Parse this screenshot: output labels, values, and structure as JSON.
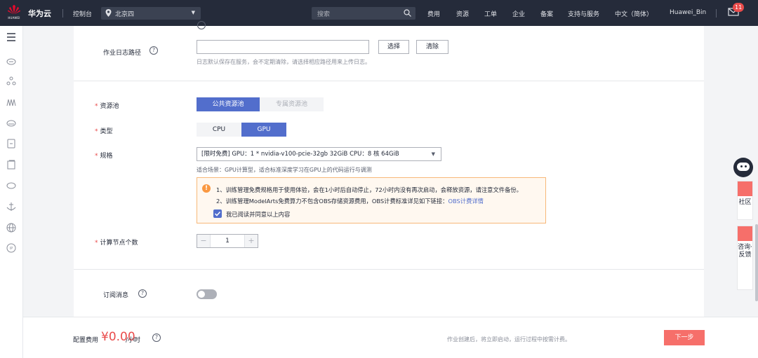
{
  "topbar": {
    "logo_word": "HUAWEI",
    "brand": "华为云",
    "console": "控制台",
    "region": "北京四",
    "search_placeholder": "搜索",
    "links": [
      "费用",
      "资源",
      "工单",
      "企业",
      "备案",
      "支持与服务",
      "中文（简体）",
      "Huawei_Bin"
    ],
    "mail_count": "11"
  },
  "sidebar": {
    "icons": [
      "menu-icon",
      "cloud-icon",
      "network-icon",
      "chart-icon",
      "cloud-storage-icon",
      "document-icon",
      "server-icon",
      "cloud-download-icon",
      "anchor-icon",
      "globe-icon",
      "ip-icon"
    ]
  },
  "form": {
    "log_path": {
      "label": "作业日志路径",
      "value": "",
      "select_btn": "选择",
      "clear_btn": "清除",
      "hint": "日志默认保存在服务，会不定期清除，请选择相应路径用来上传日志。"
    },
    "pool": {
      "label": "资源池",
      "options": [
        "公共资源池",
        "专属资源池"
      ],
      "selected": "公共资源池"
    },
    "type": {
      "label": "类型",
      "options": [
        "CPU",
        "GPU"
      ],
      "selected": "GPU"
    },
    "spec": {
      "label": "规格",
      "value": "[限时免费] GPU：1 * nvidia-v100-pcie-32gb 32GiB CPU：8 核 64GiB",
      "hint": "适合场景：GPU计算型，适合标准深度学习在GPU上的代码运行与调测"
    },
    "notice": {
      "line1": "1、训练管理免费规格用于使用体验，会在1小时后自动停止，72小时内没有再次启动，会释放资源，请注意文件备份。",
      "line2": "2、训练管理ModelArts免费算力不包含OBS存储资源费用，OBS计费标准详见如下链接：",
      "line2_link": "OBS计费详情",
      "agree": "我已阅读并同意以上内容",
      "agreed": true
    },
    "nodes": {
      "label": "计算节点个数",
      "value": "1"
    },
    "subscribe": {
      "label": "订阅消息",
      "enabled": false
    }
  },
  "footer": {
    "fee_label": "配置费用",
    "fee_value": "¥0.00",
    "fee_unit": "/小时",
    "note": "作业创建后，将立即启动，运行过程中按需计费。",
    "next": "下一步"
  },
  "float_tools": {
    "community": "社区",
    "feedback": "咨询·反馈"
  },
  "colors": {
    "topbar": "#252b3a",
    "accent": "#526ecc",
    "danger": "#e94b4b",
    "warning": "#fa9841",
    "next_button": "#f66f6a"
  }
}
